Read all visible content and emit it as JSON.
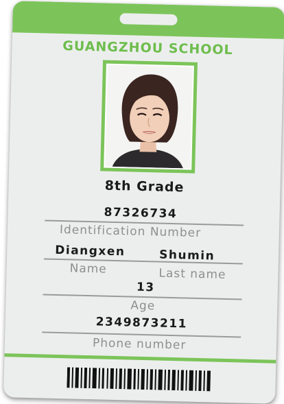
{
  "card": {
    "school": "GUANGZHOU SCHOOL",
    "grade": "8th Grade",
    "id_number": "87326734",
    "id_label": "Identification Number",
    "first_name": "Diangxen",
    "last_name": "Shumin",
    "name_label": "Name",
    "last_name_label": "Last name",
    "age": "13",
    "age_label": "Age",
    "phone": "2349873211",
    "phone_label": "Phone number"
  },
  "colors": {
    "accent_green": "#7cc45a",
    "card_background": "#eceeed"
  },
  "icons": [
    "photo-portrait",
    "barcode"
  ]
}
